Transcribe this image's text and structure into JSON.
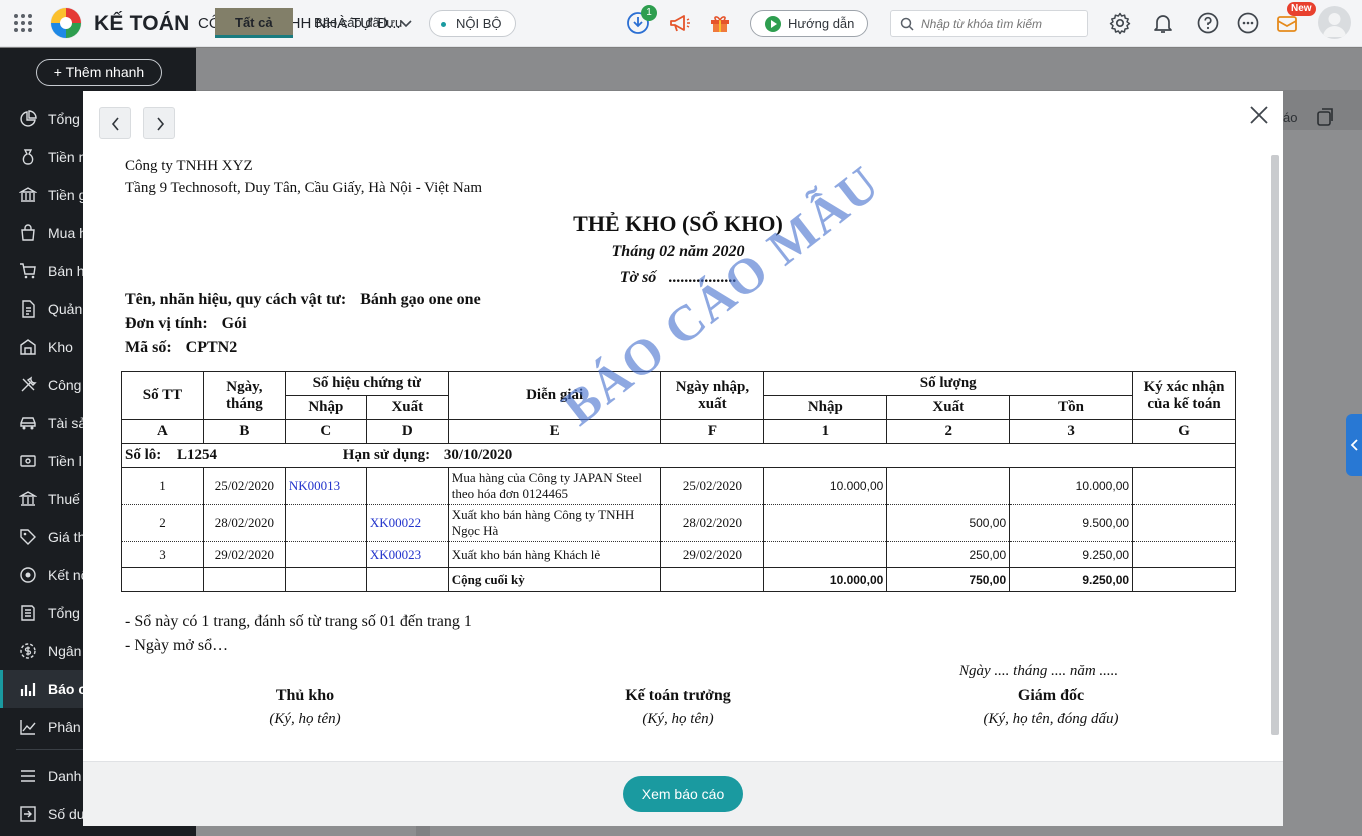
{
  "header": {
    "brand": "KẾ TOÁN",
    "company": "CÔNG TY TNHH NHÀ TỰ Đ...",
    "scope": "NỘI BỘ",
    "notification_count": "1",
    "guide_label": "Hướng dẫn",
    "search_placeholder": "Nhập từ khóa tìm kiếm",
    "new_badge": "New"
  },
  "sidebar": {
    "add_quick": "+ Thêm nhanh",
    "items": [
      {
        "label": "Tổng"
      },
      {
        "label": "Tiền m"
      },
      {
        "label": "Tiền g"
      },
      {
        "label": "Mua h"
      },
      {
        "label": "Bán h"
      },
      {
        "label": "Quản"
      },
      {
        "label": "Kho"
      },
      {
        "label": "Công"
      },
      {
        "label": "Tài sả"
      },
      {
        "label": "Tiền l"
      },
      {
        "label": "Thuế"
      },
      {
        "label": "Giá th"
      },
      {
        "label": "Kết nố"
      },
      {
        "label": "Tổng"
      },
      {
        "label": "Ngân"
      },
      {
        "label": "Báo c"
      },
      {
        "label": "Phân"
      },
      {
        "label": "Danh"
      },
      {
        "label": "Số dư"
      }
    ]
  },
  "tabs": {
    "all": "Tất cả",
    "saved": "Báo cáo đã lưu"
  },
  "background": {
    "right_text": "áo"
  },
  "report": {
    "company_name": "Công ty TNHH XYZ",
    "company_address": "Tầng 9 Technosoft, Duy Tân, Cầu Giấy, Hà Nội - Việt Nam",
    "title": "THẺ KHO (SỔ KHO)",
    "period": "Tháng 02 năm 2020",
    "sheet_label": "Tờ số",
    "sheet_dots": ".................",
    "material_label": "Tên, nhãn hiệu, quy cách vật tư:",
    "material_value": "Bánh gạo one one",
    "unit_label": "Đơn vị tính:",
    "unit_value": "Gói",
    "code_label": "Mã số:",
    "code_value": "CPTN2",
    "watermark": "BÁO CÁO MẪU",
    "headers": {
      "stt": "Số TT",
      "date": "Ngày, tháng",
      "voucher": "Số hiệu chứng từ",
      "in": "Nhập",
      "out": "Xuất",
      "desc": "Diễn giải",
      "io_date": "Ngày nhập, xuất",
      "qty": "Số lượng",
      "qty_in": "Nhập",
      "qty_out": "Xuất",
      "qty_stock": "Tồn",
      "sign": "Ký xác nhận của kế toán"
    },
    "col_labels": [
      "A",
      "B",
      "C",
      "D",
      "E",
      "F",
      "1",
      "2",
      "3",
      "G"
    ],
    "lot_label": "Số lô:",
    "lot_value": "L1254",
    "expiry_label": "Hạn sử dụng:",
    "expiry_value": "30/10/2020",
    "rows": [
      {
        "stt": "1",
        "date": "25/02/2020",
        "in_no": "NK00013",
        "out_no": "",
        "desc": "Mua hàng của Công ty JAPAN Steel theo hóa đơn 0124465",
        "io_date": "25/02/2020",
        "qty_in": "10.000,00",
        "qty_out": "",
        "stock": "10.000,00"
      },
      {
        "stt": "2",
        "date": "28/02/2020",
        "in_no": "",
        "out_no": "XK00022",
        "desc": "Xuất kho bán hàng Công ty TNHH Ngọc Hà",
        "io_date": "28/02/2020",
        "qty_in": "",
        "qty_out": "500,00",
        "stock": "9.500,00"
      },
      {
        "stt": "3",
        "date": "29/02/2020",
        "in_no": "",
        "out_no": "XK00023",
        "desc": "Xuất kho bán hàng Khách lẻ",
        "io_date": "29/02/2020",
        "qty_in": "",
        "qty_out": "250,00",
        "stock": "9.250,00"
      }
    ],
    "total": {
      "label": "Cộng cuối kỳ",
      "qty_in": "10.000,00",
      "qty_out": "750,00",
      "stock": "9.250,00"
    },
    "note1": "- Sổ này có 1 trang, đánh số từ trang số 01 đến trang 1",
    "note2": "- Ngày mở sổ…",
    "sign_date": "Ngày .... tháng .... năm .....",
    "signers": [
      {
        "title": "Thủ kho",
        "sub": "(Ký, họ tên)"
      },
      {
        "title": "Kế toán trưởng",
        "sub": "(Ký, họ tên)"
      },
      {
        "title": "Giám đốc",
        "sub": "(Ký, họ tên, đóng dấu)"
      }
    ]
  },
  "footer": {
    "view_button": "Xem báo cáo"
  },
  "colors": {
    "accent": "#1a9aa0",
    "sidebar": "#1a1d21",
    "link": "#2233cc",
    "watermark": "#426ecd"
  }
}
